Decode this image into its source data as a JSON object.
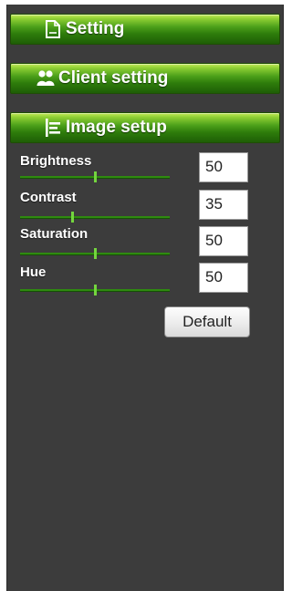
{
  "menu": {
    "setting": {
      "label": "Setting",
      "icon": "document-icon"
    },
    "client_setting": {
      "label": "Client setting",
      "icon": "users-icon"
    },
    "image_setup": {
      "label": "Image setup",
      "icon": "list-icon"
    }
  },
  "image_setup": {
    "controls": [
      {
        "label": "Brightness",
        "value": "50",
        "level_percent": 50
      },
      {
        "label": "Contrast",
        "value": "35",
        "level_percent": 35
      },
      {
        "label": "Saturation",
        "value": "50",
        "level_percent": 50
      },
      {
        "label": "Hue",
        "value": "50",
        "level_percent": 50
      }
    ],
    "default_label": "Default"
  },
  "colors": {
    "panel_background": "#3c3c3c",
    "header_green": "#2e7c0b",
    "slider_green": "#2f8a10",
    "thumb_green": "#74d63e"
  }
}
